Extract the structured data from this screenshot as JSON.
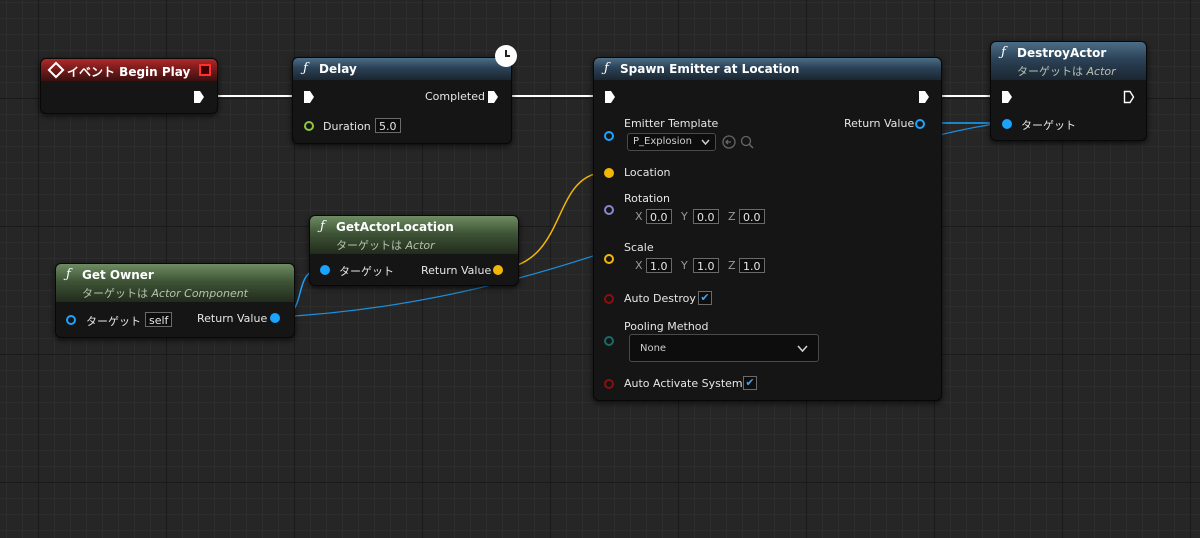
{
  "nodes": {
    "begin_play": {
      "title": "イベント Begin Play"
    },
    "delay": {
      "title": "Delay",
      "completed": "Completed",
      "duration_label": "Duration",
      "duration_value": "5.0"
    },
    "spawn_emitter": {
      "title": "Spawn Emitter at Location",
      "emitter_template_label": "Emitter Template",
      "emitter_template_value": "P_Explosion",
      "return_value": "Return Value",
      "location": "Location",
      "rotation": "Rotation",
      "rotation_x": "0.0",
      "rotation_y": "0.0",
      "rotation_z": "0.0",
      "scale": "Scale",
      "scale_x": "1.0",
      "scale_y": "1.0",
      "scale_z": "1.0",
      "auto_destroy": "Auto Destroy",
      "pooling_method": "Pooling Method",
      "pooling_value": "None",
      "auto_activate": "Auto Activate System",
      "axis_x": "X",
      "axis_y": "Y",
      "axis_z": "Z"
    },
    "destroy_actor": {
      "title": "DestroyActor",
      "subtitle_prefix": "ターゲットは",
      "subtitle_class": "Actor",
      "target": "ターゲット"
    },
    "get_actor_location": {
      "title": "GetActorLocation",
      "subtitle_prefix": "ターゲットは",
      "subtitle_class": "Actor",
      "target": "ターゲット",
      "return_value": "Return Value"
    },
    "get_owner": {
      "title": "Get Owner",
      "subtitle_prefix": "ターゲットは",
      "subtitle_class": "Actor Component",
      "target": "ターゲット",
      "self": "self",
      "return_value": "Return Value"
    }
  },
  "icons": {
    "function": "function-icon",
    "event": "event-diamond-icon",
    "latent": "clock-icon"
  },
  "colors": {
    "exec_wire": "#ffffff",
    "object_pin": "#1aa3ff",
    "vector_pin": "#f2b705",
    "rotator_pin": "#8888cc",
    "bool_pin": "#8a1010",
    "enum_pin": "#1a6b63",
    "float_pin": "#8ec63f"
  }
}
